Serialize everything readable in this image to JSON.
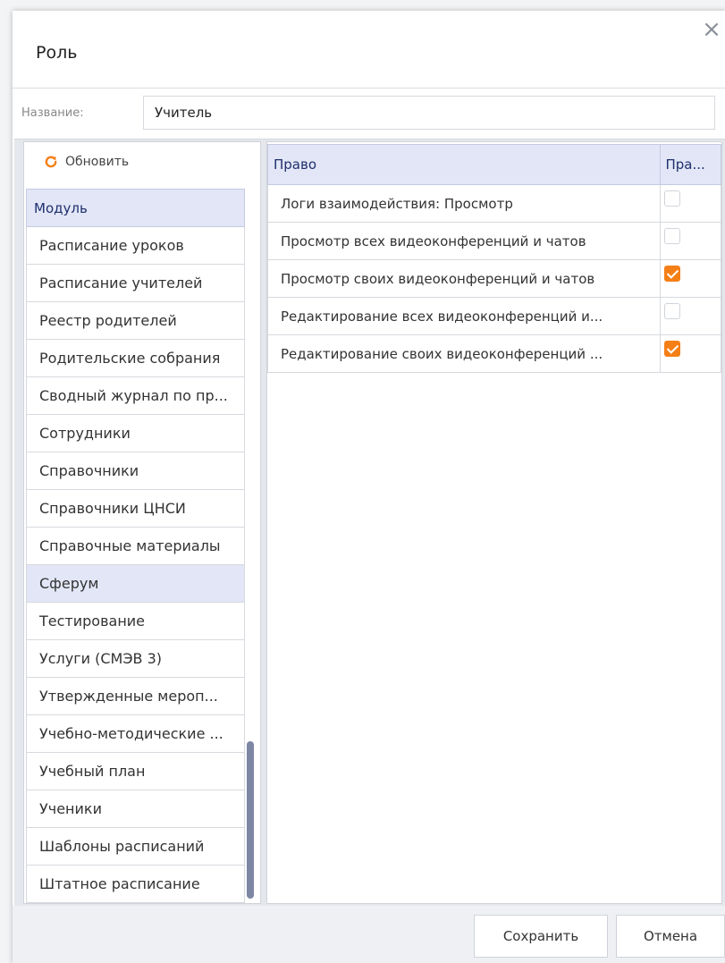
{
  "dialog": {
    "title": "Роль",
    "name_label": "Название:",
    "name_value": "Учитель"
  },
  "toolbar": {
    "refresh_label": "Обновить"
  },
  "modules": {
    "header": "Модуль",
    "items": [
      {
        "label": "Расписание уроков",
        "selected": false
      },
      {
        "label": "Расписание учителей",
        "selected": false
      },
      {
        "label": "Реестр родителей",
        "selected": false
      },
      {
        "label": "Родительские собрания",
        "selected": false
      },
      {
        "label": "Сводный журнал по пр...",
        "selected": false
      },
      {
        "label": "Сотрудники",
        "selected": false
      },
      {
        "label": "Справочники",
        "selected": false
      },
      {
        "label": "Справочники ЦНСИ",
        "selected": false
      },
      {
        "label": "Справочные материалы",
        "selected": false
      },
      {
        "label": "Сферум",
        "selected": true
      },
      {
        "label": "Тестирование",
        "selected": false
      },
      {
        "label": "Услуги (СМЭВ 3)",
        "selected": false
      },
      {
        "label": "Утвержденные мероп...",
        "selected": false
      },
      {
        "label": "Учебно-методические ...",
        "selected": false
      },
      {
        "label": "Учебный план",
        "selected": false
      },
      {
        "label": "Ученики",
        "selected": false
      },
      {
        "label": "Шаблоны расписаний",
        "selected": false
      },
      {
        "label": "Штатное расписание",
        "selected": false
      }
    ]
  },
  "rights": {
    "columns": [
      "Право",
      "Пра..."
    ],
    "rows": [
      {
        "name": "Логи взаимодействия: Просмотр",
        "checked": false
      },
      {
        "name": "Просмотр всех видеоконференций и чатов",
        "checked": false
      },
      {
        "name": "Просмотр своих видеоконференций и чатов",
        "checked": true
      },
      {
        "name": "Редактирование всех видеоконференций и...",
        "checked": false
      },
      {
        "name": "Редактирование своих видеоконференций ...",
        "checked": true
      }
    ]
  },
  "footer": {
    "save_label": "Сохранить",
    "cancel_label": "Отмена"
  },
  "colors": {
    "accent": "#f57f17",
    "header_bg": "#e2e6f6",
    "header_text": "#1f2f6e"
  },
  "icons": {
    "refresh": "refresh-icon",
    "close": "close-icon",
    "check": "check-icon"
  }
}
